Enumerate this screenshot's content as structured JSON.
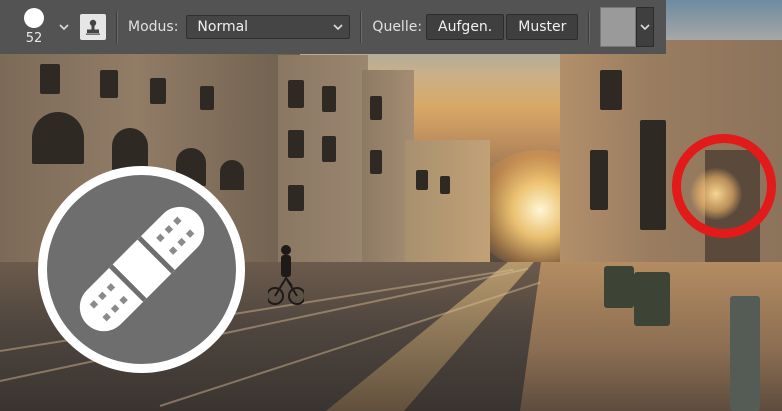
{
  "options_bar": {
    "brush_size": "52",
    "mode_label": "Modus:",
    "mode_value": "Normal",
    "source_label": "Quelle:",
    "source_buttons": [
      "Aufgen.",
      "Muster"
    ]
  },
  "icons": {
    "brush_preview": "brush-tip-icon",
    "brush_dropdown": "chevron-down-icon",
    "clone_source": "stamp-icon",
    "pattern_dropdown": "chevron-down-icon",
    "tool_overlay": "bandage-icon"
  },
  "colors": {
    "toolbar": "#535353",
    "highlight_circle": "#e21a1a",
    "overlay_badge": "#6e6e6e"
  }
}
